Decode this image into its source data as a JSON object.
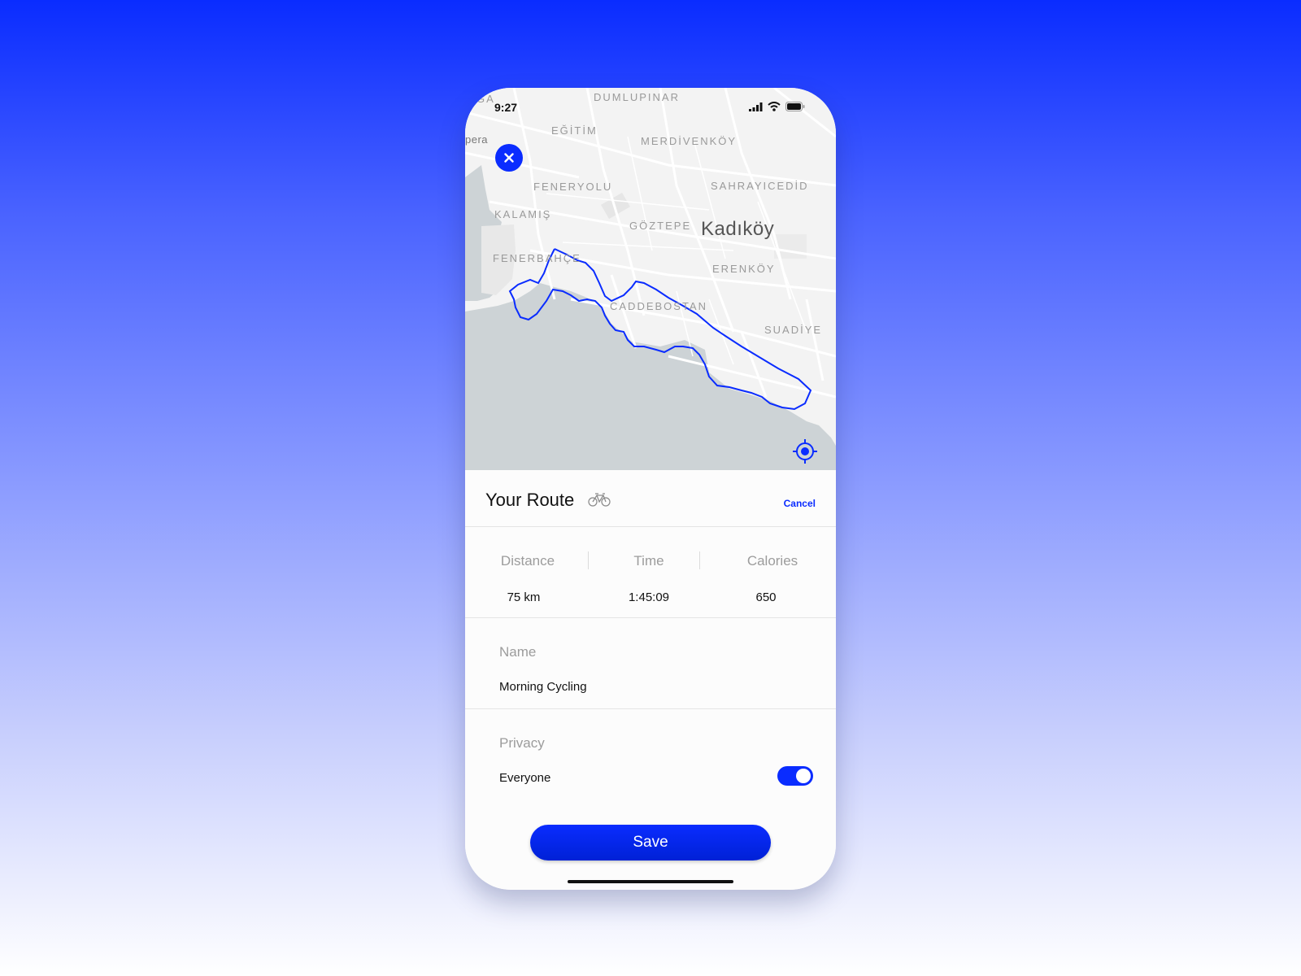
{
  "status_bar": {
    "time": "9:27"
  },
  "map": {
    "labels": {
      "dumlupinar": "DUMLUPINAR",
      "egitim": "EĞİTİM",
      "merdivenkoy": "MERDİVENKÖY",
      "opera": "pera",
      "ga": "GA",
      "feneryolu": "FENERYOLU",
      "sahrayicedid": "SAHRAYICEDİD",
      "kalamis": "KALAMIŞ",
      "goztepe": "GÖZTEPE",
      "kadikoy": "Kadıköy",
      "fenerbahce": "FENERBAHÇE",
      "erenkoy": "ERENKÖY",
      "caddebostan": "CADDEBOSTAN",
      "suadiye": "SUADİYE"
    },
    "route_color": "#0a2cff"
  },
  "sheet": {
    "title": "Your Route",
    "activity_icon": "bicycle-icon",
    "cancel_label": "Cancel",
    "stats": {
      "distance_label": "Distance",
      "distance_value": "75 km",
      "time_label": "Time",
      "time_value": "1:45:09",
      "calories_label": "Calories",
      "calories_value": "650"
    },
    "name_label": "Name",
    "name_value": "Morning Cycling",
    "privacy_label": "Privacy",
    "privacy_value": "Everyone",
    "privacy_toggle_on": true,
    "save_label": "Save"
  },
  "colors": {
    "accent": "#0a2cff",
    "water": "#cdd3d6",
    "land": "#f3f3f3"
  }
}
